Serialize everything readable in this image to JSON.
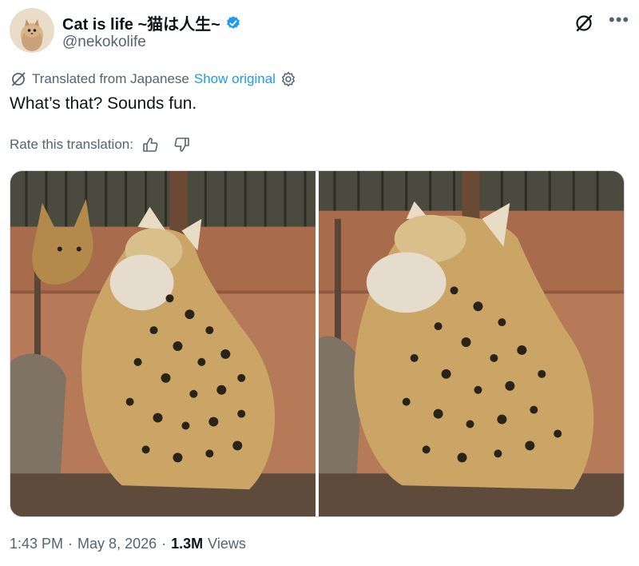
{
  "author": {
    "display_name": "Cat is life ~猫は人生~",
    "handle": "@nekokolife"
  },
  "translation": {
    "label": "Translated from Japanese",
    "show_original": "Show original"
  },
  "tweet": {
    "text": "What’s that? Sounds fun."
  },
  "rating": {
    "label": "Rate this translation:"
  },
  "media": {
    "photos": [
      {
        "alt": ""
      },
      {
        "alt": ""
      }
    ]
  },
  "meta": {
    "time": "1:43 PM",
    "separator1": "·",
    "date": "May 8, 2026",
    "separator2": "·",
    "views_count": "1.3M",
    "views_label": "Views"
  },
  "colors": {
    "link": "#1d9bf0",
    "muted": "#536471",
    "text": "#0f1419",
    "verified": "#1d9bf0"
  },
  "icons": [
    "avatar",
    "verified-icon",
    "grok-icon",
    "more-icon",
    "translate-icon",
    "gear-icon",
    "thumbs-up-icon",
    "thumbs-down-icon"
  ]
}
